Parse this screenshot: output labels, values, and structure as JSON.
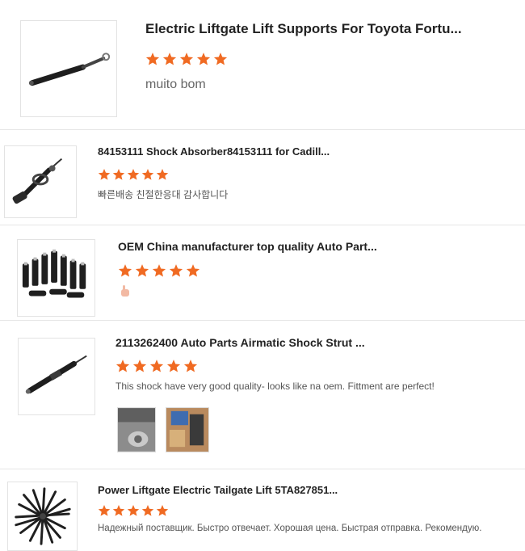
{
  "colors": {
    "star": "#f06a22",
    "text": "#222222",
    "review": "#555555"
  },
  "reviews": [
    {
      "title": "Electric Liftgate Lift Supports For Toyota Fortu...",
      "rating": 5,
      "comment": "muito bom",
      "image": "gas-strut-product-image"
    },
    {
      "title": "84153111 Shock Absorber84153111 for Cadill...",
      "rating": 5,
      "comment": "빠른배송 친절한응대 감사합니다",
      "image": "shock-absorber-product-image"
    },
    {
      "title": "OEM China manufacturer top quality Auto Part...",
      "rating": 5,
      "comment": "",
      "image": "air-struts-product-image"
    },
    {
      "title": "2113262400 Auto Parts Airmatic Shock Strut ...",
      "rating": 5,
      "comment": "This shock have very good quality- looks like na oem. Fittment are perfect!",
      "image": "airmatic-strut-product-image"
    },
    {
      "title": "Power Liftgate Electric Tailgate Lift 5TA827851...",
      "rating": 5,
      "comment": "Надежный поставщик. Быстро отвечает. Хорошая цена. Быстрая отправка. Рекомендую.",
      "image": "tailgate-struts-product-image"
    }
  ]
}
